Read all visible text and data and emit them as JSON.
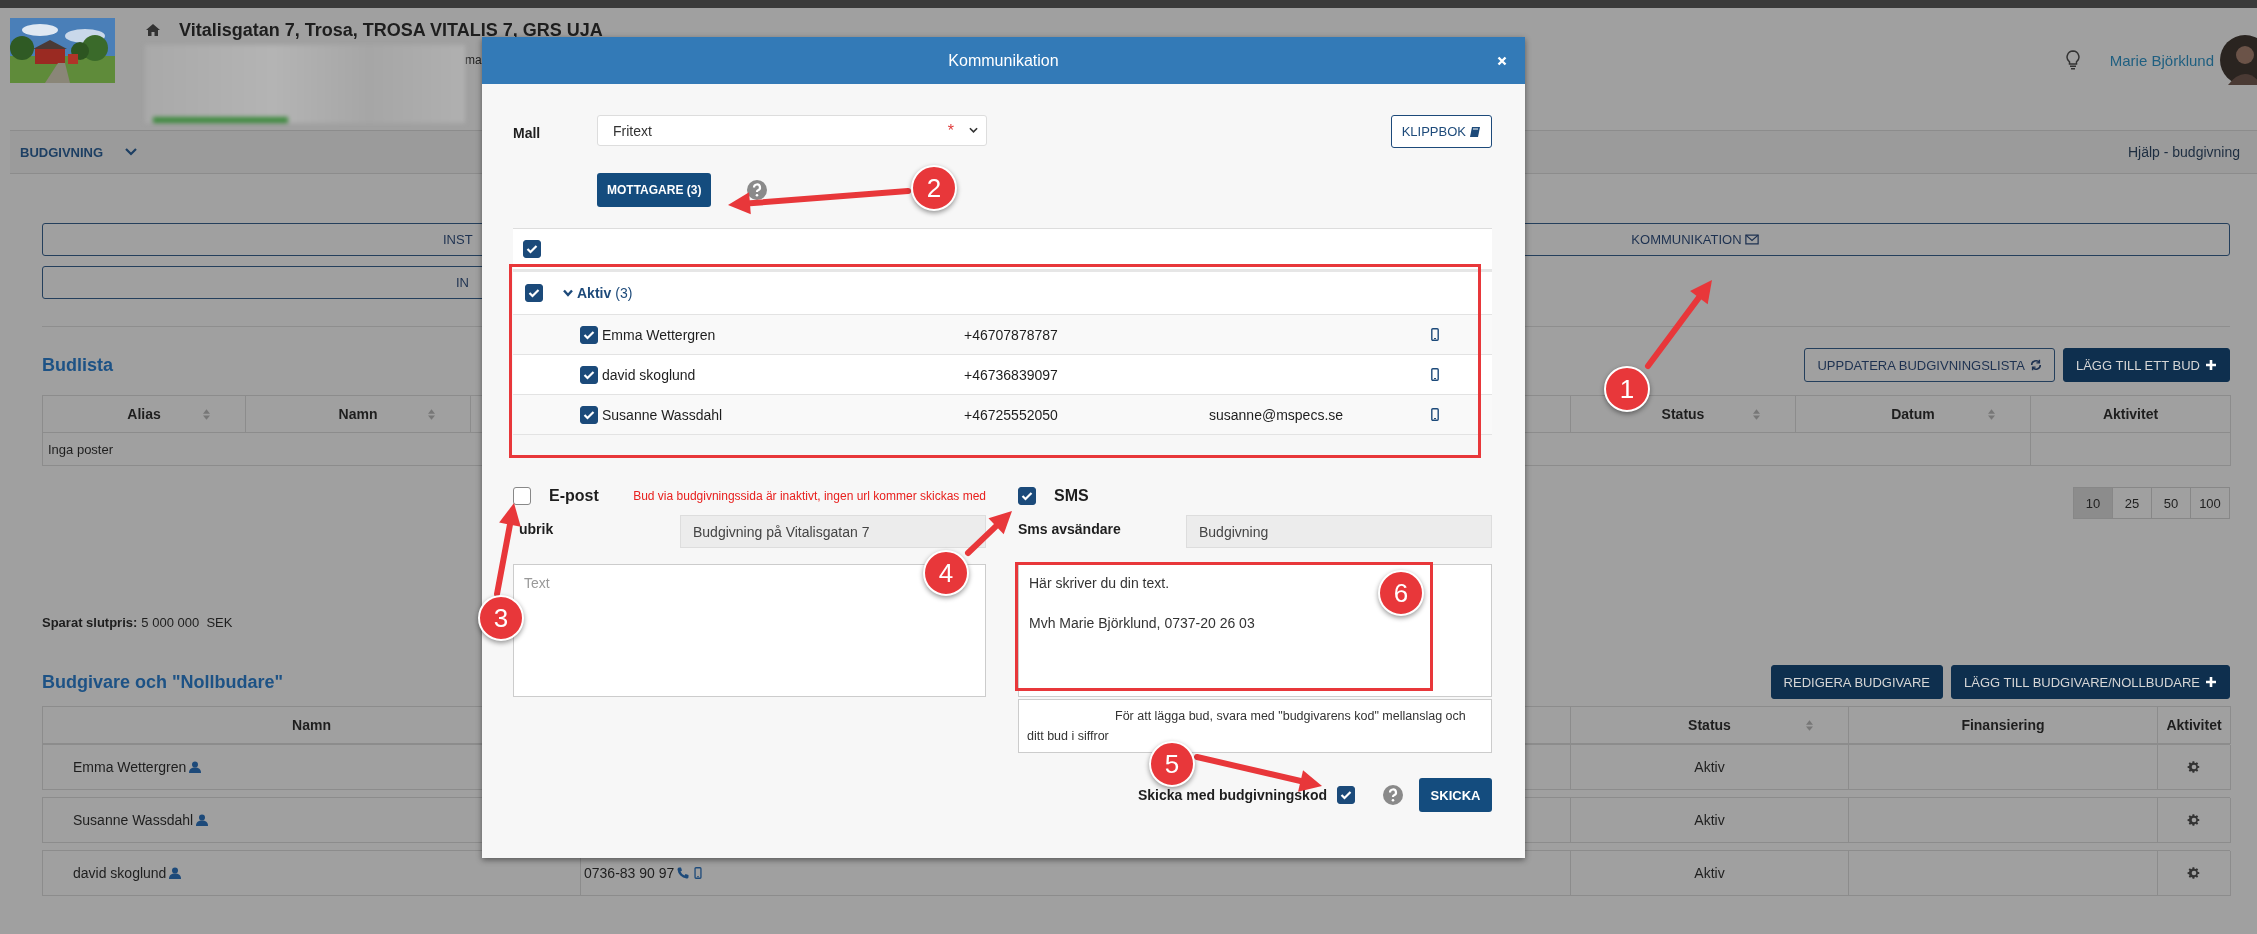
{
  "header": {
    "title": "Vitalisgatan 7, Trosa, TROSA VITALIS 7, GRS UJA",
    "fragment": "ma",
    "user": "Marie Björklund"
  },
  "nav": {
    "menu": "BUDGIVNING",
    "help": "Hjälp - budgivning"
  },
  "action_buttons": [
    {
      "label": "INST"
    },
    {
      "label": "KOMMUNIKATION"
    },
    {
      "label": "IN"
    }
  ],
  "budlista": {
    "title": "Budlista",
    "buttons": [
      {
        "label": "UPPDATERA BUDGIVNINGSLISTA",
        "kind": "outline"
      },
      {
        "label": "LÄGG TILL ETT BUD",
        "kind": "primary"
      }
    ],
    "columns_left": [
      {
        "label": "Alias",
        "sortable": true
      },
      {
        "label": "Namn",
        "sortable": true
      }
    ],
    "columns_right": [
      {
        "label": "Status",
        "sortable": true
      },
      {
        "label": "Datum",
        "sortable": true
      },
      {
        "label": "Aktivitet",
        "sortable": false
      }
    ],
    "empty": "Inga poster",
    "page_sizes": [
      {
        "label": "10",
        "selected": true
      },
      {
        "label": "25",
        "selected": false
      },
      {
        "label": "50",
        "selected": false
      },
      {
        "label": "100",
        "selected": false
      }
    ]
  },
  "final_price": {
    "label": "Sparat slutpris:",
    "value": "5 000 000  SEK"
  },
  "bidders": {
    "title": "Budgivare och \"Nollbudare\"",
    "buttons": [
      {
        "label": "REDIGERA BUDGIVARE",
        "kind": "primary"
      },
      {
        "label": "LÄGG TILL BUDGIVARE/NOLLBUDARE",
        "kind": "primary"
      }
    ],
    "columns_left": [
      {
        "label": "Namn"
      }
    ],
    "columns_right": [
      {
        "label": "Status",
        "sortable": true
      },
      {
        "label": "Finansiering",
        "sortable": false
      },
      {
        "label": "Aktivitet",
        "sortable": false
      }
    ],
    "rows": [
      {
        "name": "Emma Wettergren",
        "status": "Aktiv"
      },
      {
        "name": "Susanne Wassdahl",
        "status": "Aktiv"
      },
      {
        "name": "david skoglund",
        "phone": "0736-83 90 97",
        "status": "Aktiv"
      }
    ]
  },
  "modal": {
    "title": "Kommunikation",
    "template": {
      "label": "Mall",
      "value": "Fritext",
      "required_mark": "*"
    },
    "clipboard_button": "KLIPPBOK",
    "recipients_button": "MOTTAGARE (3)",
    "select_all": {
      "checked": true
    },
    "groups": [
      {
        "name": "Aktiv",
        "count": "(3)",
        "checked": true,
        "expanded": true,
        "recipients": [
          {
            "name": "Emma Wettergren",
            "phone": "+46707878787",
            "checked": true
          },
          {
            "name": "david skoglund",
            "phone": "+46736839097",
            "checked": true
          },
          {
            "name": "Susanne Wassdahl",
            "phone": "+46725552050",
            "email": "susanne@mspecs.se",
            "checked": true
          }
        ]
      }
    ],
    "email": {
      "label": "E-post",
      "checked": false,
      "warning": "Bud via budgivningssida är inaktivt, ingen url kommer skickas med",
      "subject_label": "ubrik",
      "subject": "Budgivning på Vitalisgatan 7",
      "body_placeholder": "Text"
    },
    "sms": {
      "label": "SMS",
      "checked": true,
      "sender_label": "Sms avsändare",
      "sender": "Budgivning",
      "body": "Här skriver du din text.\n\nMvh Marie Björklund, 0737-20 26 03",
      "footer": "För att lägga bud, svara med \"budgivarens kod\" mellanslag och ditt bud i siffror"
    },
    "send_code": {
      "label": "Skicka med budgivningskod",
      "checked": true
    },
    "send_button": "SKICKA"
  },
  "annotations": [
    {
      "label": "1"
    },
    {
      "label": "2"
    },
    {
      "label": "3"
    },
    {
      "label": "4"
    },
    {
      "label": "5"
    },
    {
      "label": "6"
    }
  ]
}
